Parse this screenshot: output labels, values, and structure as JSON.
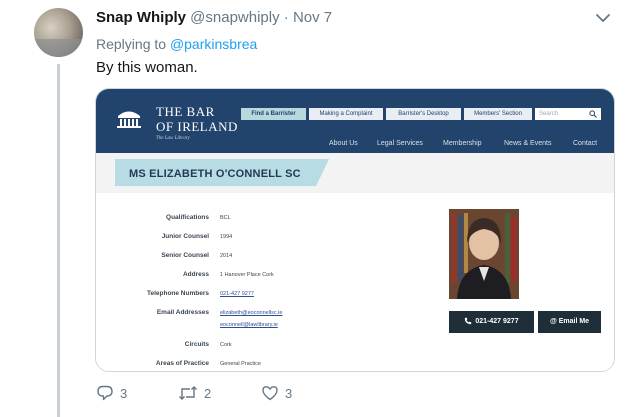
{
  "tweet": {
    "display_name": "Snap Whiply",
    "handle": "@snapwhiply",
    "separator": "·",
    "date": "Nov 7",
    "replying_prefix": "Replying to",
    "replying_handle": "@parkinsbrea",
    "text": "By this woman."
  },
  "site": {
    "logo_line1": "THE BAR",
    "logo_line2": "OF IRELAND",
    "logo_sub": "The Law Library",
    "top_buttons": [
      "Find a Barrister",
      "Making a Complaint",
      "Barrister's Desktop",
      "Members' Section"
    ],
    "search_placeholder": "Search",
    "nav": [
      "About Us",
      "Legal Services",
      "Membership",
      "News & Events",
      "Contact"
    ],
    "profile_name": "MS ELIZABETH O'CONNELL SC",
    "fields": [
      {
        "label": "Qualifications",
        "value": "BCL"
      },
      {
        "label": "Junior Counsel",
        "value": "1994"
      },
      {
        "label": "Senior Counsel",
        "value": "2014"
      },
      {
        "label": "Address",
        "value": "1 Hanover Place Cork"
      },
      {
        "label": "Telephone Numbers",
        "value": "021-427 9277"
      },
      {
        "label": "Email Addresses",
        "value": "elizabeth@eoconnellsc.ie",
        "value2": "eoconnell@lawlibrary.ie"
      },
      {
        "label": "Circuits",
        "value": "Cork"
      },
      {
        "label": "Areas of Practice",
        "value": "General Practice"
      }
    ],
    "phone_button": "021-427 9277",
    "email_button": "@ Email Me"
  },
  "actions": {
    "reply_count": "3",
    "retweet_count": "2",
    "like_count": "3"
  },
  "colors": {
    "site_header": "#21436c",
    "accent_link": "#1da1f2",
    "name_box": "#b8dce4"
  }
}
